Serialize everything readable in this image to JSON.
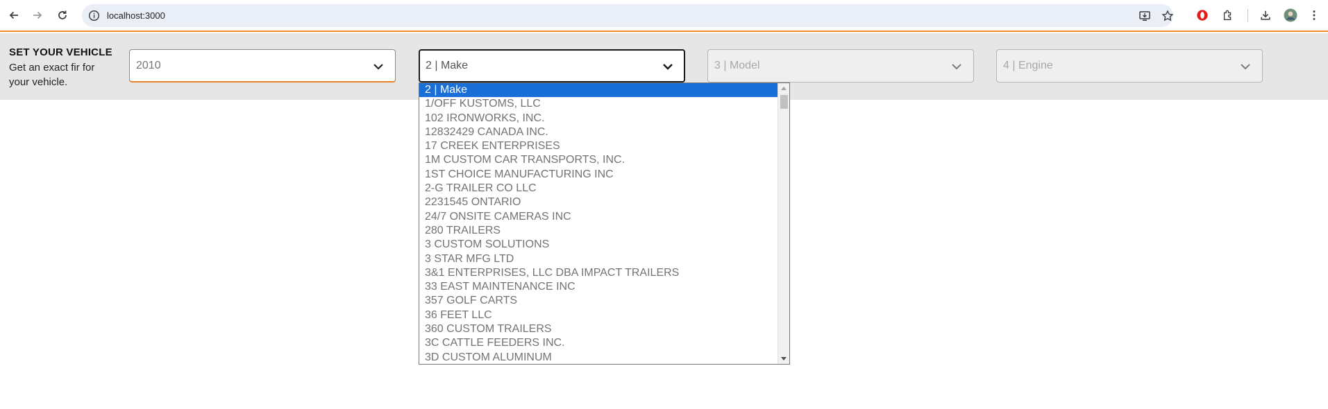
{
  "browser": {
    "url": "localhost:3000",
    "back_icon": "back-arrow-icon",
    "forward_icon": "forward-arrow-icon",
    "reload_icon": "reload-icon",
    "colors": {
      "omnibox_bg": "#eaeef7",
      "accent_line": "#f08a24"
    }
  },
  "vehicle": {
    "title": "SET YOUR VEHICLE",
    "subtitle": "Get an exact fir for your vehicle.",
    "year_select": {
      "value": "2010"
    },
    "make_select": {
      "value": "2 | Make"
    },
    "model_select": {
      "value": "3 | Model"
    },
    "engine_select": {
      "value": "4 | Engine"
    }
  },
  "make_dropdown": {
    "options": [
      "2 | Make",
      "1/OFF KUSTOMS, LLC",
      "102 IRONWORKS, INC.",
      "12832429 CANADA INC.",
      "17 CREEK ENTERPRISES",
      "1M CUSTOM CAR TRANSPORTS, INC.",
      "1ST CHOICE MANUFACTURING INC",
      "2-G TRAILER CO LLC",
      "2231545 ONTARIO",
      "24/7 ONSITE CAMERAS INC",
      "280 TRAILERS",
      "3 CUSTOM SOLUTIONS",
      "3 STAR MFG LTD",
      "3&1 ENTERPRISES, LLC DBA IMPACT TRAILERS",
      "33 EAST MAINTENANCE INC",
      "357 GOLF CARTS",
      "36 FEET LLC",
      "360 CUSTOM TRAILERS",
      "3C CATTLE FEEDERS INC.",
      "3D CUSTOM ALUMINUM"
    ],
    "selected_index": 0,
    "highlight_color": "#1a6ed8"
  }
}
